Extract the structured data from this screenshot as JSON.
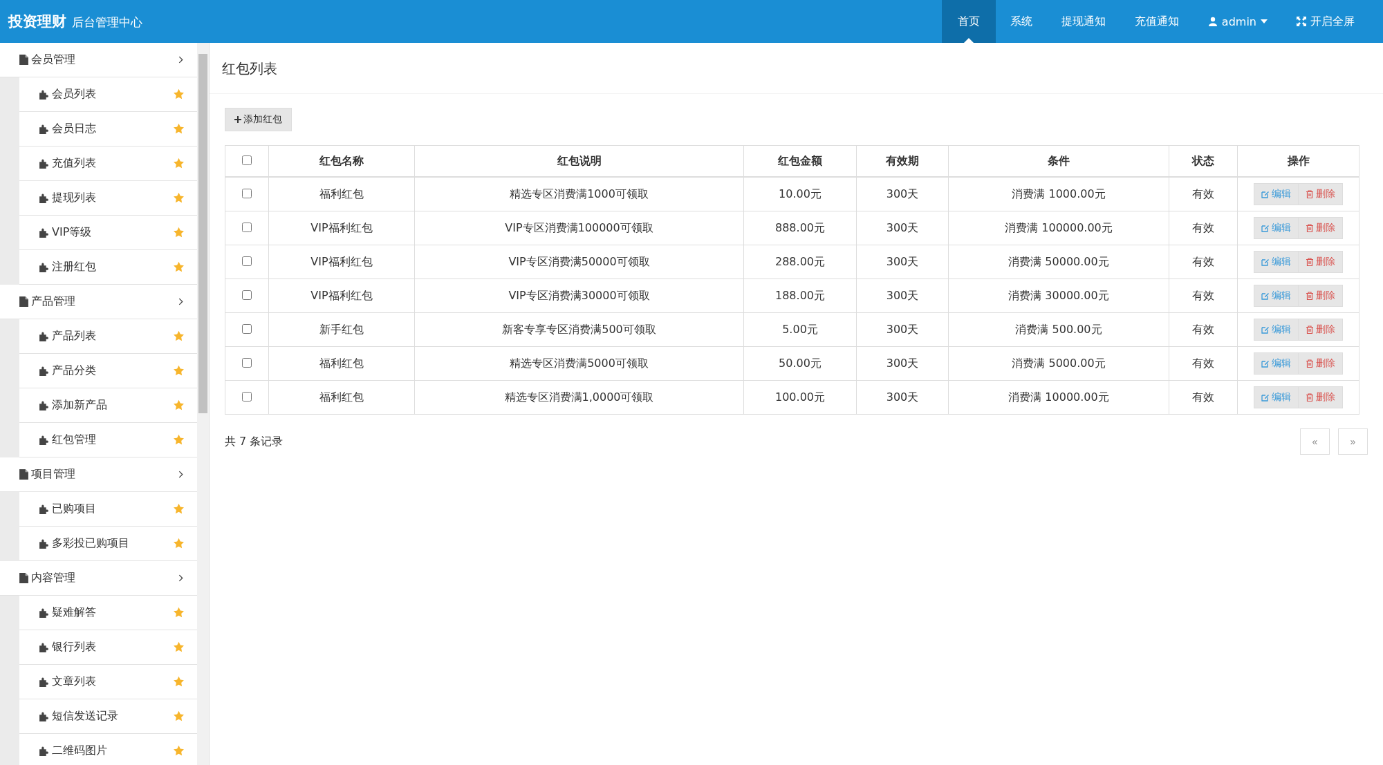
{
  "header": {
    "logo": "投资理财",
    "subtitle": "后台管理中心",
    "nav": [
      {
        "label": "首页",
        "selected": true,
        "kind": "link"
      },
      {
        "label": "系统",
        "selected": false,
        "kind": "link"
      },
      {
        "label": "提现通知",
        "selected": false,
        "kind": "link"
      },
      {
        "label": "充值通知",
        "selected": false,
        "kind": "link"
      },
      {
        "label": "admin",
        "selected": false,
        "kind": "user"
      },
      {
        "label": "开启全屏",
        "selected": false,
        "kind": "fullscreen"
      }
    ]
  },
  "sidebar": {
    "groups": [
      {
        "label": "会员管理",
        "expanded": true,
        "children": [
          {
            "label": "会员列表"
          },
          {
            "label": "会员日志"
          },
          {
            "label": "充值列表"
          },
          {
            "label": "提现列表"
          },
          {
            "label": "VIP等级"
          },
          {
            "label": "注册红包"
          }
        ]
      },
      {
        "label": "产品管理",
        "expanded": true,
        "children": [
          {
            "label": "产品列表"
          },
          {
            "label": "产品分类"
          },
          {
            "label": "添加新产品"
          },
          {
            "label": "红包管理"
          }
        ]
      },
      {
        "label": "项目管理",
        "expanded": true,
        "children": [
          {
            "label": "已购项目"
          },
          {
            "label": "多彩投已购项目"
          }
        ]
      },
      {
        "label": "内容管理",
        "expanded": true,
        "children": [
          {
            "label": "疑难解答"
          },
          {
            "label": "银行列表"
          },
          {
            "label": "文章列表"
          },
          {
            "label": "短信发送记录"
          },
          {
            "label": "二维码图片"
          }
        ]
      }
    ]
  },
  "page": {
    "title": "红包列表",
    "add_button": "添加红包",
    "table": {
      "select_all": {
        "checked": false
      },
      "columns": [
        "红包名称",
        "红包说明",
        "红包金额",
        "有效期",
        "条件",
        "状态",
        "操作"
      ],
      "rows": [
        {
          "checked": false,
          "cells": [
            "福利红包",
            "精选专区消费满1000可领取",
            "10.00元",
            "300天",
            "消费满 1000.00元",
            "有效"
          ],
          "actions": [
            "编辑",
            "删除"
          ]
        },
        {
          "checked": false,
          "cells": [
            "VIP福利红包",
            "VIP专区消费满100000可领取",
            "888.00元",
            "300天",
            "消费满 100000.00元",
            "有效"
          ],
          "actions": [
            "编辑",
            "删除"
          ]
        },
        {
          "checked": false,
          "cells": [
            "VIP福利红包",
            "VIP专区消费满50000可领取",
            "288.00元",
            "300天",
            "消费满 50000.00元",
            "有效"
          ],
          "actions": [
            "编辑",
            "删除"
          ]
        },
        {
          "checked": false,
          "cells": [
            "VIP福利红包",
            "VIP专区消费满30000可领取",
            "188.00元",
            "300天",
            "消费满 30000.00元",
            "有效"
          ],
          "actions": [
            "编辑",
            "删除"
          ]
        },
        {
          "checked": false,
          "cells": [
            "新手红包",
            "新客专享专区消费满500可领取",
            "5.00元",
            "300天",
            "消费满 500.00元",
            "有效"
          ],
          "actions": [
            "编辑",
            "删除"
          ]
        },
        {
          "checked": false,
          "cells": [
            "福利红包",
            "精选专区消费满5000可领取",
            "50.00元",
            "300天",
            "消费满 5000.00元",
            "有效"
          ],
          "actions": [
            "编辑",
            "删除"
          ]
        },
        {
          "checked": false,
          "cells": [
            "福利红包",
            "精选专区消费满1,0000可领取",
            "100.00元",
            "300天",
            "消费满 10000.00元",
            "有效"
          ],
          "actions": [
            "编辑",
            "删除"
          ]
        }
      ]
    },
    "record_count": "共 7 条记录",
    "pagination": {
      "prev": "«",
      "next": "»"
    }
  }
}
